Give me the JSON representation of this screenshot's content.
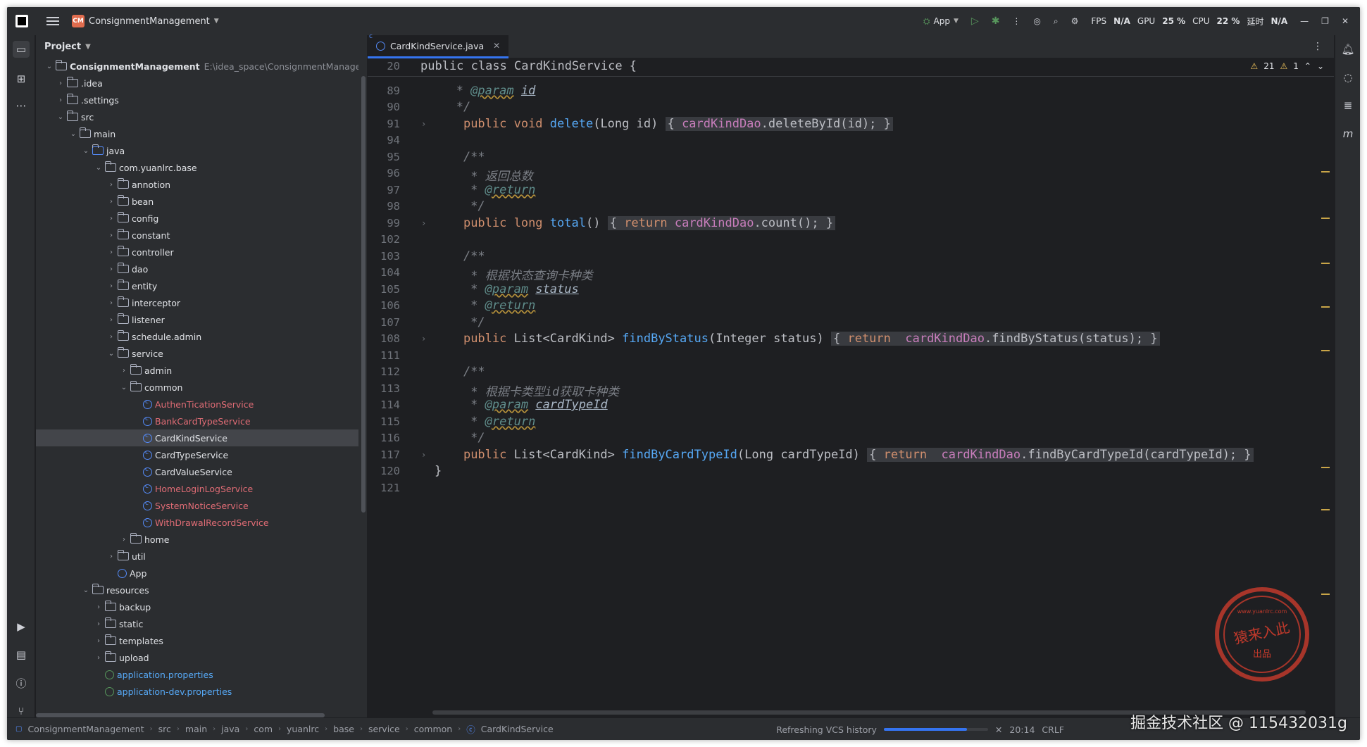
{
  "titlebar": {
    "project_badge": "CM",
    "project_name": "ConsignmentManagement",
    "run_config": "App",
    "stats": [
      "FPS",
      "N/A",
      "GPU",
      "25 %",
      "CPU",
      "22 %",
      "延时",
      "N/A"
    ]
  },
  "project_panel": {
    "title": "Project",
    "root_name": "ConsignmentManagement",
    "root_path": "E:\\idea_space\\ConsignmentManagement",
    "items": [
      {
        "label": "ConsignmentManagement",
        "depth": 0
      },
      {
        "label": ".idea",
        "depth": 1
      },
      {
        "label": ".settings",
        "depth": 1
      },
      {
        "label": "src",
        "depth": 1
      },
      {
        "label": "main",
        "depth": 2
      },
      {
        "label": "java",
        "depth": 3
      },
      {
        "label": "com.yuanlrc.base",
        "depth": 4
      },
      {
        "label": "annotion",
        "depth": 5
      },
      {
        "label": "bean",
        "depth": 5
      },
      {
        "label": "config",
        "depth": 5
      },
      {
        "label": "constant",
        "depth": 5
      },
      {
        "label": "controller",
        "depth": 5
      },
      {
        "label": "dao",
        "depth": 5
      },
      {
        "label": "entity",
        "depth": 5
      },
      {
        "label": "interceptor",
        "depth": 5
      },
      {
        "label": "listener",
        "depth": 5
      },
      {
        "label": "schedule.admin",
        "depth": 5
      },
      {
        "label": "service",
        "depth": 5
      },
      {
        "label": "admin",
        "depth": 6
      },
      {
        "label": "common",
        "depth": 6
      },
      {
        "label": "AuthenTicationService",
        "depth": 7
      },
      {
        "label": "BankCardTypeService",
        "depth": 7
      },
      {
        "label": "CardKindService",
        "depth": 7
      },
      {
        "label": "CardTypeService",
        "depth": 7
      },
      {
        "label": "CardValueService",
        "depth": 7
      },
      {
        "label": "HomeLoginLogService",
        "depth": 7
      },
      {
        "label": "SystemNoticeService",
        "depth": 7
      },
      {
        "label": "WithDrawalRecordService",
        "depth": 7
      },
      {
        "label": "home",
        "depth": 6
      },
      {
        "label": "util",
        "depth": 5
      },
      {
        "label": "App",
        "depth": 5
      },
      {
        "label": "resources",
        "depth": 3
      },
      {
        "label": "backup",
        "depth": 4
      },
      {
        "label": "static",
        "depth": 4
      },
      {
        "label": "templates",
        "depth": 4
      },
      {
        "label": "upload",
        "depth": 4
      },
      {
        "label": "application.properties",
        "depth": 4
      },
      {
        "label": "application-dev.properties",
        "depth": 4
      }
    ]
  },
  "editor": {
    "tab_label": "CardKindService.java",
    "sticky_line_no": "20",
    "sticky_code": "public class CardKindService {",
    "warnings": "21",
    "weak_warnings": "1",
    "line_numbers": [
      "89",
      "90",
      "91",
      "94",
      "95",
      "96",
      "97",
      "98",
      "99",
      "102",
      "103",
      "104",
      "105",
      "106",
      "107",
      "108",
      "111",
      "112",
      "113",
      "114",
      "115",
      "116",
      "117",
      "120",
      "121"
    ],
    "lines": {
      "l89": "@param",
      "l89b": "id",
      "l91a": "public void ",
      "l91fn": "delete",
      "l91b": "(Long id)",
      "l91c": "cardKindDao",
      "l91d": ".deleteById(id);",
      "l96": "* 返回总数",
      "l97": "@return",
      "l99a": "public long ",
      "l99fn": "total",
      "l99b": "()",
      "l99c": "return ",
      "l99d": "cardKindDao",
      "l99e": ".count();",
      "l104": "* 根据状态查询卡种类",
      "l105": "@param",
      "l105b": "status",
      "l106": "@return",
      "l108a": "public ",
      "l108b": "List<CardKind> ",
      "l108fn": "findByStatus",
      "l108c": "(Integer status)",
      "l108d": "return  ",
      "l108e": "cardKindDao",
      "l108f": ".findByStatus(status);",
      "l113": "* 根据卡类型id获取卡种类",
      "l114": "@param",
      "l114b": "cardTypeId",
      "l115": "@return",
      "l117a": "public ",
      "l117b": "List<CardKind> ",
      "l117fn": "findByCardTypeId",
      "l117c": "(Long cardTypeId)",
      "l117d": "return  ",
      "l117e": "cardKindDao",
      "l117f": ".findByCardTypeId(cardTypeId);",
      "l120": "}"
    }
  },
  "statusbar": {
    "breadcrumb": [
      "ConsignmentManagement",
      "src",
      "main",
      "java",
      "com",
      "yuanlrc",
      "base",
      "service",
      "common",
      "CardKindService"
    ],
    "vcs_text": "Refreshing VCS history",
    "vcs_progress": 0.8,
    "position": "20:14",
    "line_sep": "CRLF"
  },
  "watermark": {
    "text": "掘金技术社区 @ 115432031g",
    "stamp_text": "猿来入此",
    "stamp_sub": "出品",
    "stamp_url": "www.yuanlrc.com"
  },
  "colors": {
    "accent": "#3574f0",
    "keyword": "#cf8e6d",
    "function": "#56a8f5",
    "field": "#c77dbb",
    "comment": "#7a7e85",
    "error_file": "#e06c75"
  }
}
